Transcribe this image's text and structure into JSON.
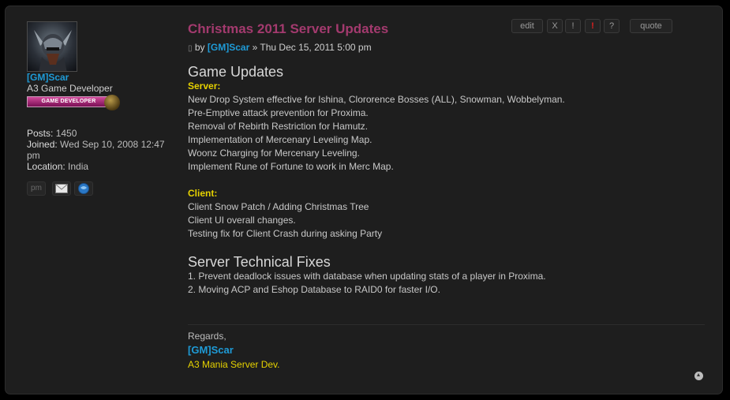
{
  "profile": {
    "username": "[GM]Scar",
    "rank_title": "A3 Game Developer",
    "rank_badge": "GAME DEVELOPER",
    "posts_label": "Posts:",
    "posts_value": "1450",
    "joined_label": "Joined:",
    "joined_value": "Wed Sep 10, 2008 12:47 pm",
    "location_label": "Location:",
    "location_value": "India",
    "contact": {
      "pm_label": "pm",
      "email_icon": "email-icon",
      "website_icon": "website-icon"
    }
  },
  "post": {
    "title": "Christmas 2011 Server Updates",
    "by": "by",
    "author": "[GM]Scar",
    "separator": "»",
    "date": "Thu Dec 15, 2011 5:00 pm",
    "actions": {
      "edit": "edit",
      "delete": "X",
      "info": "!",
      "report": "!",
      "warn": "?",
      "quote": "quote"
    },
    "sections": {
      "game_updates_heading": "Game Updates",
      "server_label": "Server:",
      "server_items": [
        "New Drop System effective for Ishina, Clororence Bosses (ALL), Snowman, Wobbelyman.",
        "Pre-Emptive attack prevention for Proxima.",
        "Removal of Rebirth Restriction for Hamutz.",
        "Implementation of Mercenary Leveling Map.",
        "Woonz Charging for Mercenary Leveling.",
        "Implement Rune of Fortune to work in Merc Map."
      ],
      "client_label": "Client:",
      "client_items": [
        "Client Snow Patch / Adding Christmas Tree",
        "Client UI overall changes.",
        "Testing fix for Client Crash during asking Party"
      ],
      "fixes_heading": "Server Technical Fixes",
      "fixes_items": [
        "1. Prevent deadlock issues with database when updating stats of a player in Proxima.",
        "2. Moving ACP and Eshop Database to RAID0 for faster I/O."
      ]
    },
    "signature": {
      "regards": "Regards,",
      "name": "[GM]Scar",
      "role": "A3 Mania Server Dev."
    }
  },
  "colors": {
    "title": "#a33a6e",
    "username": "#1e9bd7",
    "highlight": "#e6d200",
    "report": "#e02020"
  }
}
